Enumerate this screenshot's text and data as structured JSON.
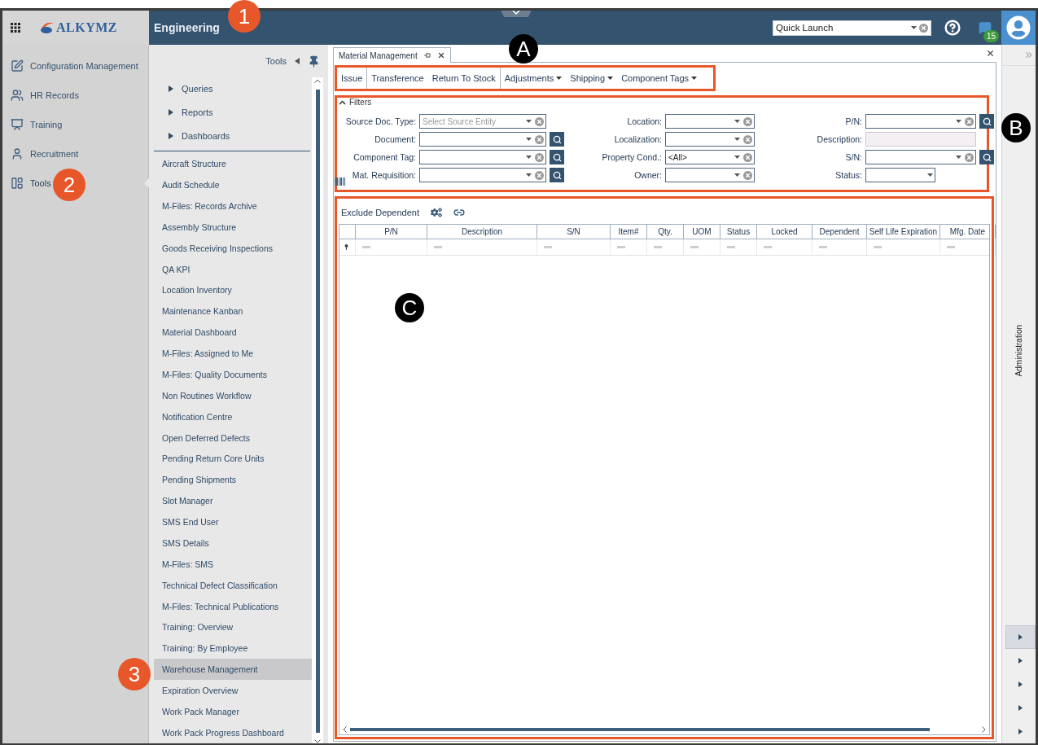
{
  "app_bar": {
    "logo": "ALKYMZ",
    "module": "Engineering",
    "quick_launch": {
      "value": "Quick Launch"
    },
    "notifications": "15"
  },
  "nav": [
    {
      "label": "Configuration Management",
      "selected": false
    },
    {
      "label": "HR Records",
      "selected": false
    },
    {
      "label": "Training",
      "selected": false
    },
    {
      "label": "Recruitment",
      "selected": false
    },
    {
      "label": "Tools",
      "selected": true
    }
  ],
  "tools_panel": {
    "title": "Tools",
    "groups": [
      {
        "label": "Queries",
        "expanded": false
      },
      {
        "label": "Reports",
        "expanded": false
      },
      {
        "label": "Dashboards",
        "expanded": false
      }
    ],
    "items": [
      {
        "label": "Aircraft Structure",
        "selected": false
      },
      {
        "label": "Audit Schedule",
        "selected": false
      },
      {
        "label": "M-Files: Records Archive",
        "selected": false
      },
      {
        "label": "Assembly Structure",
        "selected": false
      },
      {
        "label": "Goods Receiving Inspections",
        "selected": false
      },
      {
        "label": "QA KPI",
        "selected": false
      },
      {
        "label": "Location Inventory",
        "selected": false
      },
      {
        "label": "Maintenance Kanban",
        "selected": false
      },
      {
        "label": "Material Dashboard",
        "selected": false
      },
      {
        "label": "M-Files: Assigned to Me",
        "selected": false
      },
      {
        "label": "M-Files: Quality Documents",
        "selected": false
      },
      {
        "label": "Non Routines Workflow",
        "selected": false
      },
      {
        "label": "Notification Centre",
        "selected": false
      },
      {
        "label": "Open Deferred Defects",
        "selected": false
      },
      {
        "label": "Pending Return Core Units",
        "selected": false
      },
      {
        "label": "Pending Shipments",
        "selected": false
      },
      {
        "label": "Slot Manager",
        "selected": false
      },
      {
        "label": "SMS End User",
        "selected": false
      },
      {
        "label": "SMS Details",
        "selected": false
      },
      {
        "label": "M-Files: SMS",
        "selected": false
      },
      {
        "label": "Technical Defect Classification",
        "selected": false
      },
      {
        "label": "M-Files: Technical Publications",
        "selected": false
      },
      {
        "label": "Training: Overview",
        "selected": false
      },
      {
        "label": "Training: By Employee",
        "selected": false
      },
      {
        "label": "Warehouse Management",
        "selected": true
      },
      {
        "label": "Expiration Overview",
        "selected": false
      },
      {
        "label": "Work Pack Manager",
        "selected": false
      },
      {
        "label": "Work Pack Progress Dashboard",
        "selected": false
      }
    ]
  },
  "tabs": [
    {
      "label": "Material Management",
      "selected": true
    }
  ],
  "toolbar": {
    "outlined": true,
    "buttons": [
      {
        "label": "Issue",
        "kind": "button",
        "separator_after": true
      },
      {
        "label": "Transference",
        "kind": "button",
        "separator_after": false
      },
      {
        "label": "Return To Stock",
        "kind": "button",
        "separator_after": true
      },
      {
        "label": "Adjustments",
        "kind": "menu",
        "separator_after": false
      },
      {
        "label": "Shipping",
        "kind": "menu",
        "separator_after": false
      },
      {
        "label": "Component Tags",
        "kind": "menu",
        "separator_after": false
      }
    ]
  },
  "filters": {
    "title": "Filters",
    "expanded": true,
    "outlined": true,
    "fields": [
      {
        "label": "Source Doc. Type:",
        "kind": "combo",
        "placeholder": "Select Source Entity",
        "lookup": false
      },
      {
        "label": "Location:",
        "kind": "combo",
        "lookup": false
      },
      {
        "label": "P/N:",
        "kind": "combo",
        "lookup": true
      },
      {
        "label": "Document:",
        "kind": "combo",
        "lookup": true
      },
      {
        "label": "Localization:",
        "kind": "combo",
        "lookup": false
      },
      {
        "label": "Description:",
        "kind": "text",
        "lookup": false
      },
      {
        "label": "Component Tag:",
        "kind": "combo",
        "lookup": true
      },
      {
        "label": "Property Cond.:",
        "kind": "combo",
        "value": "<All>",
        "lookup": false
      },
      {
        "label": "S/N:",
        "kind": "combo",
        "lookup": true
      },
      {
        "label": "Mat. Requisition:",
        "kind": "combo",
        "lookup": true
      },
      {
        "label": "Owner:",
        "kind": "combo",
        "lookup": false
      },
      {
        "label": "Status:",
        "kind": "select",
        "lookup": false
      }
    ]
  },
  "grid": {
    "outlined": true,
    "toolbar_label": "Exclude Dependent",
    "columns": [
      "P/N",
      "Description",
      "S/N",
      "Item#",
      "Qty.",
      "UOM",
      "Status",
      "Locked",
      "Dependent",
      "Self Life Expiration",
      "Mfg. Date"
    ]
  },
  "right_panel": {
    "label": "Administration",
    "buttons": [
      {
        "selected": true
      },
      {
        "selected": false
      },
      {
        "selected": false
      },
      {
        "selected": false
      },
      {
        "selected": false
      }
    ]
  },
  "callouts": [
    {
      "label": "1",
      "kind": "orange"
    },
    {
      "label": "2",
      "kind": "orange"
    },
    {
      "label": "3",
      "kind": "orange"
    },
    {
      "label": "A",
      "kind": "black"
    },
    {
      "label": "B",
      "kind": "black"
    },
    {
      "label": "C",
      "kind": "black"
    }
  ]
}
